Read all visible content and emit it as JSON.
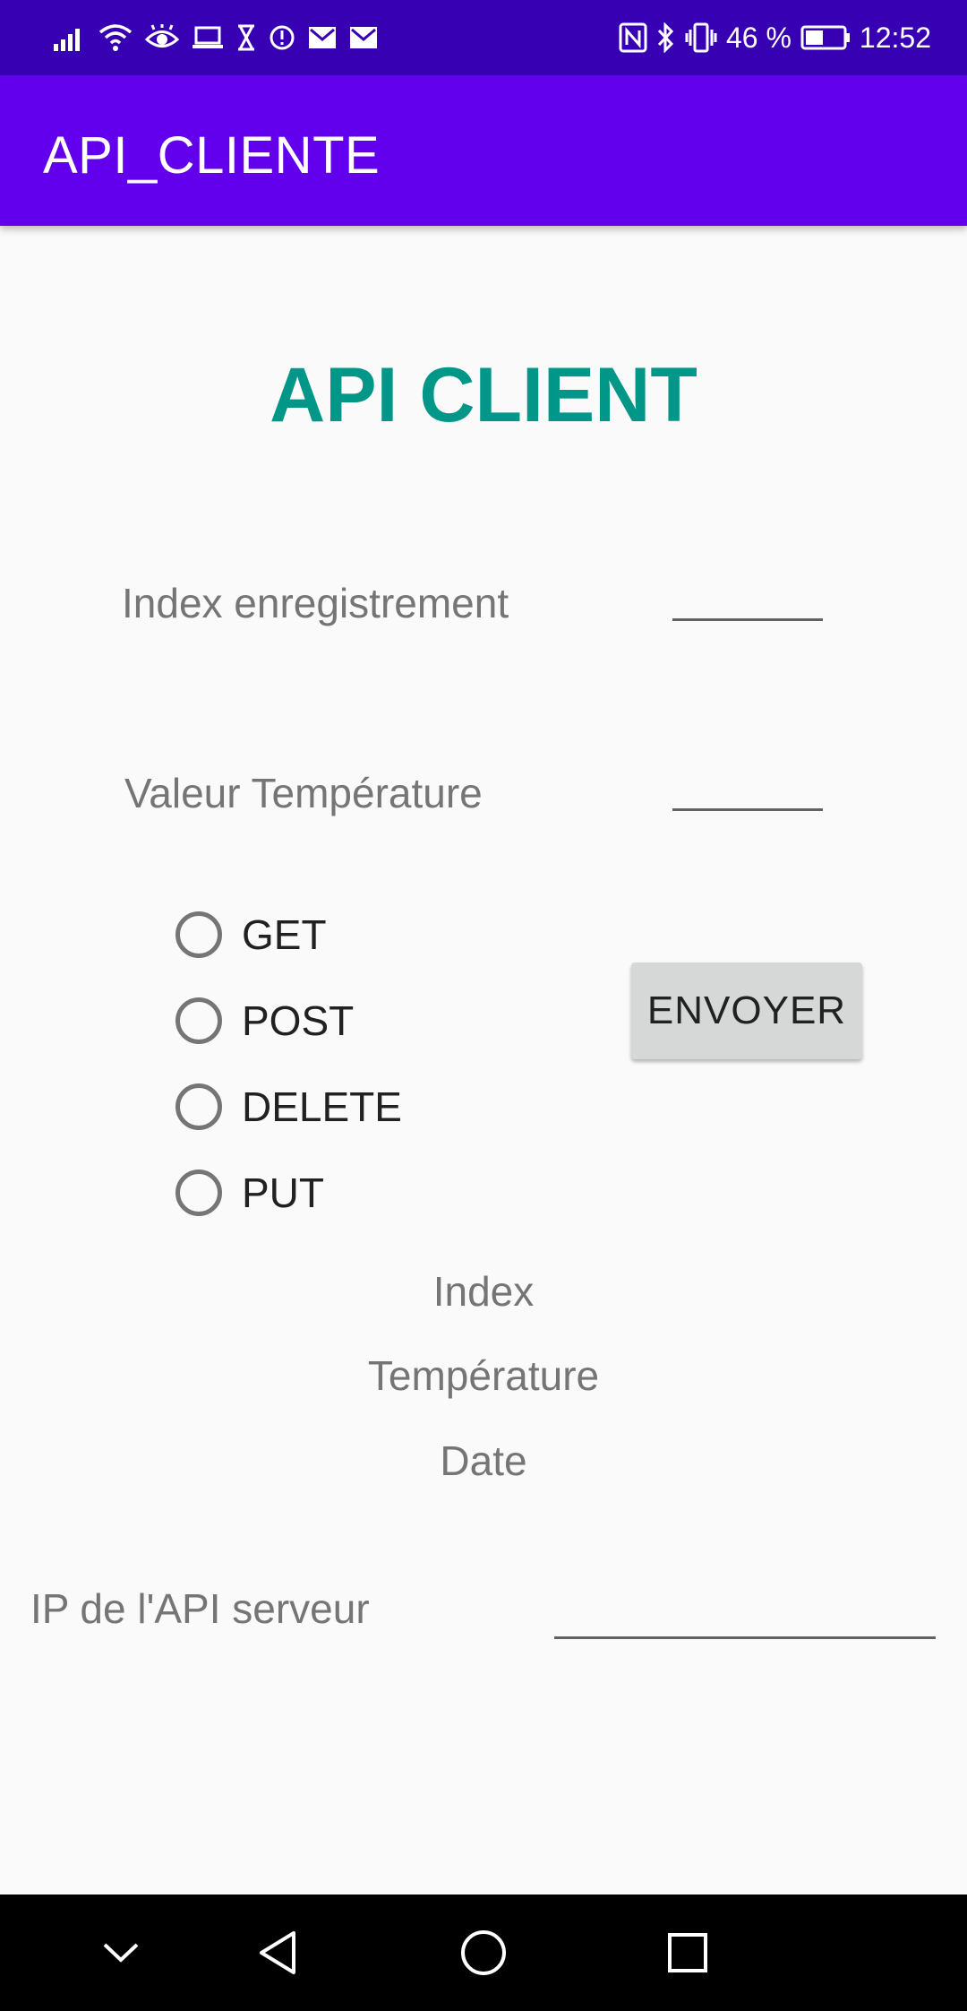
{
  "status_bar": {
    "battery_percent": "46 %",
    "time": "12:52",
    "icons_left": [
      "signal-icon",
      "wifi-icon",
      "eye-icon",
      "laptop-icon",
      "hourglass-icon",
      "alert-icon",
      "mail-icon",
      "mail-icon"
    ],
    "icons_right": [
      "nfc-icon",
      "bluetooth-icon",
      "vibrate-icon",
      "battery-icon"
    ]
  },
  "app_bar": {
    "title": "API_CLIENTE",
    "color": "#6200ee",
    "status_color": "#3700b3"
  },
  "main": {
    "heading": "API CLIENT",
    "heading_color": "#009688",
    "index_label": "Index enregistrement",
    "index_value": "",
    "temperature_label": "Valeur Température",
    "temperature_value": "",
    "methods": [
      "GET",
      "POST",
      "DELETE",
      "PUT"
    ],
    "send_label": "ENVOYER",
    "result_index": "Index",
    "result_temperature": "Température",
    "result_date": "Date",
    "ip_label": "IP de l'API serveur",
    "ip_value": ""
  },
  "nav_bar": {
    "icons": [
      "chevron-down-icon",
      "back-icon",
      "home-icon",
      "recents-icon"
    ]
  }
}
